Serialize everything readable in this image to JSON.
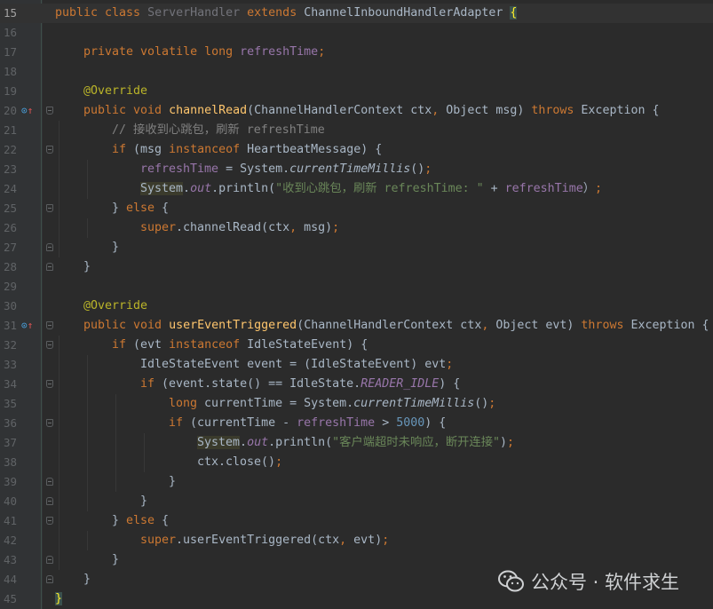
{
  "editor": {
    "colors": {
      "background": "#2b2b2b",
      "keyword": "#cc7832",
      "field": "#9876aa",
      "annotation": "#bbb529",
      "method": "#ffc66d",
      "string": "#6a8759",
      "number": "#6897bb",
      "comment": "#808080",
      "text": "#a9b7c6"
    },
    "lines": [
      {
        "n": "15",
        "current": true,
        "indent": 0,
        "tokens": [
          [
            "kw",
            "public class "
          ],
          [
            "unused",
            "ServerHandler "
          ],
          [
            "kw",
            "extends "
          ],
          [
            "",
            "ChannelInboundHandlerAdapter "
          ],
          [
            "brace",
            "{"
          ]
        ]
      },
      {
        "n": "16",
        "indent": 0,
        "tokens": []
      },
      {
        "n": "17",
        "indent": 1,
        "tokens": [
          [
            "kw",
            "private volatile long "
          ],
          [
            "fld",
            "refreshTime"
          ],
          [
            "kw",
            ";"
          ]
        ]
      },
      {
        "n": "18",
        "indent": 0,
        "tokens": []
      },
      {
        "n": "19",
        "indent": 1,
        "tokens": [
          [
            "ann",
            "@Override"
          ]
        ]
      },
      {
        "n": "20",
        "indent": 1,
        "icons": "override",
        "fold": "start",
        "tokens": [
          [
            "kw",
            "public void "
          ],
          [
            "fn",
            "channelRead"
          ],
          [
            "",
            "(ChannelHandlerContext ctx"
          ],
          [
            "kw",
            ", "
          ],
          [
            "",
            "Object msg) "
          ],
          [
            "kw",
            "throws "
          ],
          [
            "",
            "Exception {"
          ]
        ]
      },
      {
        "n": "21",
        "indent": 2,
        "tokens": [
          [
            "cmt",
            "// 接收到心跳包，刷新 refreshTime"
          ]
        ]
      },
      {
        "n": "22",
        "indent": 2,
        "fold": "start",
        "tokens": [
          [
            "kw",
            "if "
          ],
          [
            "",
            "(msg "
          ],
          [
            "kw",
            "instanceof "
          ],
          [
            "",
            "HeartbeatMessage) {"
          ]
        ]
      },
      {
        "n": "23",
        "indent": 3,
        "tokens": [
          [
            "fld",
            "refreshTime "
          ],
          [
            "",
            "= System."
          ],
          [
            "it",
            "currentTimeMillis"
          ],
          [
            "",
            "()"
          ],
          [
            "kw",
            ";"
          ]
        ]
      },
      {
        "n": "24",
        "indent": 3,
        "tokens": [
          [
            "hl",
            "System"
          ],
          [
            "",
            "."
          ],
          [
            "sfld",
            "out"
          ],
          [
            "",
            ".println("
          ],
          [
            "str",
            "\"收到心跳包，刷新 refreshTime: \" "
          ],
          [
            "",
            "+ "
          ],
          [
            "fld",
            "refreshTime"
          ],
          [
            "",
            "）"
          ],
          [
            "kw",
            ";"
          ]
        ]
      },
      {
        "n": "25",
        "indent": 2,
        "fold": "mid",
        "tokens": [
          [
            "",
            "} "
          ],
          [
            "kw",
            "else "
          ],
          [
            "",
            "{"
          ]
        ]
      },
      {
        "n": "26",
        "indent": 3,
        "tokens": [
          [
            "kw",
            "super"
          ],
          [
            "",
            ".channelRead(ctx"
          ],
          [
            "kw",
            ", "
          ],
          [
            "",
            "msg)"
          ],
          [
            "kw",
            ";"
          ]
        ]
      },
      {
        "n": "27",
        "indent": 2,
        "fold": "end",
        "tokens": [
          [
            "",
            "}"
          ]
        ]
      },
      {
        "n": "28",
        "indent": 1,
        "fold": "end",
        "tokens": [
          [
            "",
            "}"
          ]
        ]
      },
      {
        "n": "29",
        "indent": 0,
        "tokens": []
      },
      {
        "n": "30",
        "indent": 1,
        "tokens": [
          [
            "ann",
            "@Override"
          ]
        ]
      },
      {
        "n": "31",
        "indent": 1,
        "icons": "override",
        "fold": "start",
        "tokens": [
          [
            "kw",
            "public void "
          ],
          [
            "fn",
            "userEventTriggered"
          ],
          [
            "",
            "(ChannelHandlerContext ctx"
          ],
          [
            "kw",
            ", "
          ],
          [
            "",
            "Object evt) "
          ],
          [
            "kw",
            "throws "
          ],
          [
            "",
            "Exception {"
          ]
        ]
      },
      {
        "n": "32",
        "indent": 2,
        "fold": "start",
        "tokens": [
          [
            "kw",
            "if "
          ],
          [
            "",
            "(evt "
          ],
          [
            "kw",
            "instanceof "
          ],
          [
            "",
            "IdleStateEvent) {"
          ]
        ]
      },
      {
        "n": "33",
        "indent": 3,
        "tokens": [
          [
            "",
            "IdleStateEvent event = (IdleStateEvent) evt"
          ],
          [
            "kw",
            ";"
          ]
        ]
      },
      {
        "n": "34",
        "indent": 3,
        "fold": "start",
        "tokens": [
          [
            "kw",
            "if "
          ],
          [
            "",
            "(event.state() == IdleState."
          ],
          [
            "sfld",
            "READER_IDLE"
          ],
          [
            "",
            ") {"
          ]
        ]
      },
      {
        "n": "35",
        "indent": 4,
        "tokens": [
          [
            "kw",
            "long "
          ],
          [
            "",
            "currentTime = System."
          ],
          [
            "it",
            "currentTimeMillis"
          ],
          [
            "",
            "()"
          ],
          [
            "kw",
            ";"
          ]
        ]
      },
      {
        "n": "36",
        "indent": 4,
        "fold": "start",
        "tokens": [
          [
            "kw",
            "if "
          ],
          [
            "",
            "(currentTime - "
          ],
          [
            "fld",
            "refreshTime "
          ],
          [
            "",
            "> "
          ],
          [
            "num",
            "5000"
          ],
          [
            "",
            ") {"
          ]
        ]
      },
      {
        "n": "37",
        "indent": 5,
        "tokens": [
          [
            "hl",
            "System"
          ],
          [
            "",
            "."
          ],
          [
            "sfld",
            "out"
          ],
          [
            "",
            ".println("
          ],
          [
            "str",
            "\"客户端超时未响应，断开连接\""
          ],
          [
            "",
            ")"
          ],
          [
            "kw",
            ";"
          ]
        ]
      },
      {
        "n": "38",
        "indent": 5,
        "tokens": [
          [
            "",
            "ctx.close()"
          ],
          [
            "kw",
            ";"
          ]
        ]
      },
      {
        "n": "39",
        "indent": 4,
        "fold": "end",
        "tokens": [
          [
            "",
            "}"
          ]
        ]
      },
      {
        "n": "40",
        "indent": 3,
        "fold": "end",
        "tokens": [
          [
            "",
            "}"
          ]
        ]
      },
      {
        "n": "41",
        "indent": 2,
        "fold": "mid",
        "tokens": [
          [
            "",
            "} "
          ],
          [
            "kw",
            "else "
          ],
          [
            "",
            "{"
          ]
        ]
      },
      {
        "n": "42",
        "indent": 3,
        "tokens": [
          [
            "kw",
            "super"
          ],
          [
            "",
            ".userEventTriggered(ctx"
          ],
          [
            "kw",
            ", "
          ],
          [
            "",
            "evt)"
          ],
          [
            "kw",
            ";"
          ]
        ]
      },
      {
        "n": "43",
        "indent": 2,
        "fold": "end",
        "tokens": [
          [
            "",
            "}"
          ]
        ]
      },
      {
        "n": "44",
        "indent": 1,
        "fold": "end",
        "tokens": [
          [
            "",
            "}"
          ]
        ]
      },
      {
        "n": "45",
        "indent": 0,
        "tokens": [
          [
            "brace",
            "}"
          ]
        ]
      }
    ]
  },
  "watermark": {
    "text": "公众号 · 软件求生",
    "icon": "wechat-icon"
  }
}
